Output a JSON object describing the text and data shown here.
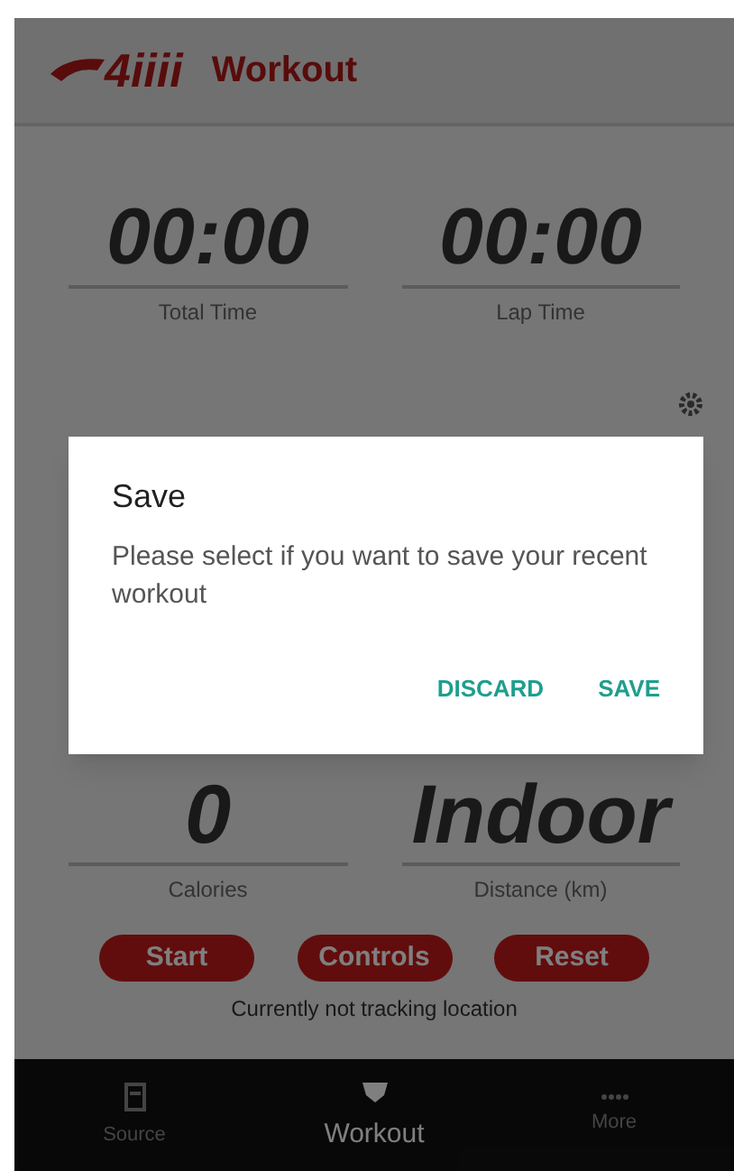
{
  "header": {
    "logo_text": "4iiii",
    "title": "Workout"
  },
  "stats": [
    {
      "value": "00:00",
      "label": "Total Time"
    },
    {
      "value": "00:00",
      "label": "Lap Time"
    }
  ],
  "stats_lower": [
    {
      "value": "0",
      "label": "Calories"
    },
    {
      "value": "Indoor",
      "label": "Distance (km)"
    }
  ],
  "buttons": [
    "Start",
    "Controls",
    "Reset"
  ],
  "status": "Currently not tracking location",
  "nav": [
    {
      "label": "Source",
      "selected": false
    },
    {
      "label": "Workout",
      "selected": true
    },
    {
      "label": "More",
      "selected": false
    }
  ],
  "dialog": {
    "title": "Save",
    "message": "Please select if you want to save your recent workout",
    "actions": [
      "DISCARD",
      "SAVE"
    ]
  }
}
